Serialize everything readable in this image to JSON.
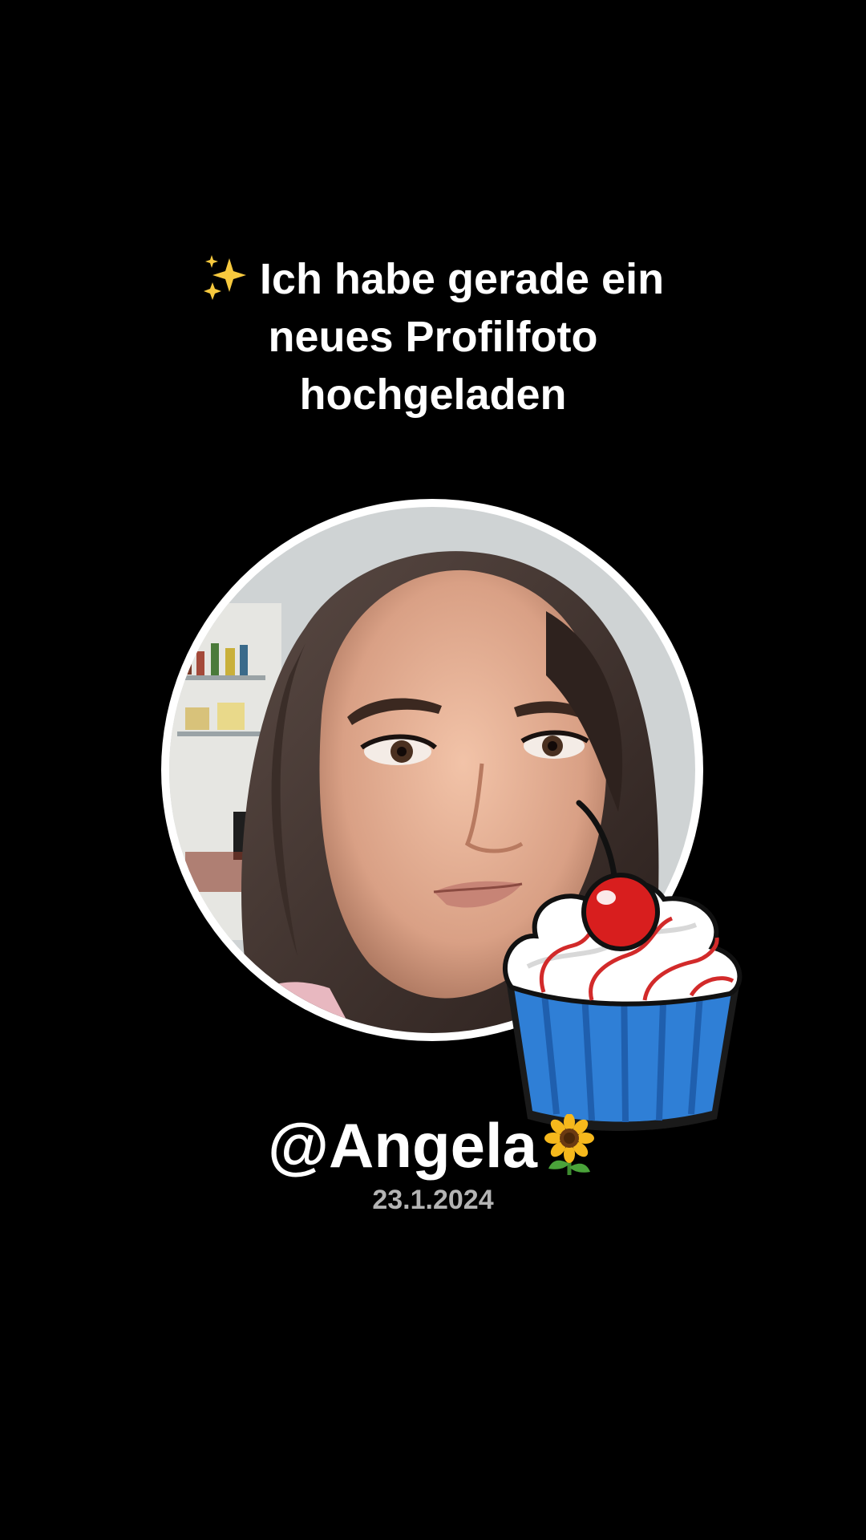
{
  "post": {
    "headline_icon": "sparkles-icon",
    "headline_lines": [
      "Ich habe gerade ein",
      "neues Profilfoto",
      "hochgeladen"
    ],
    "username": "@Angela",
    "username_emoji": "sunflower-icon",
    "date": "23.1.2024",
    "sticker": "cupcake-cherry-icon"
  },
  "colors": {
    "background": "#000000",
    "text": "#ffffff",
    "date_text": "#b4b4b4",
    "avatar_ring": "#ffffff"
  }
}
